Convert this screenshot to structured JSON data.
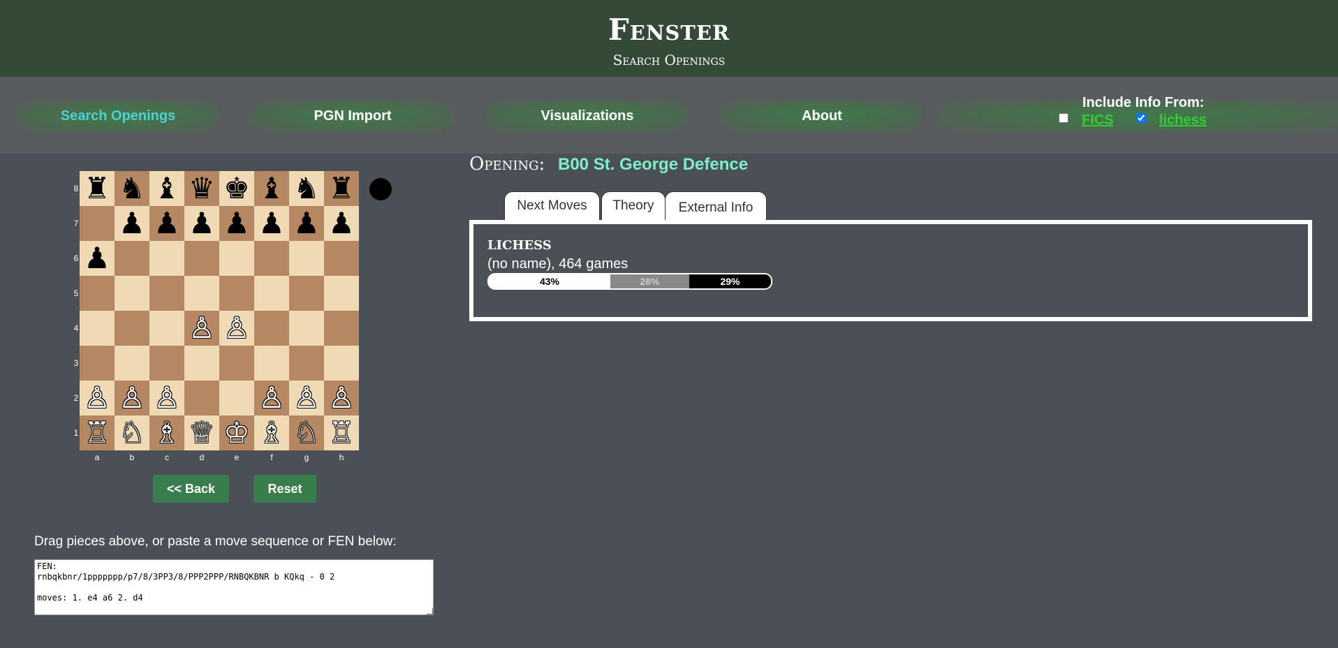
{
  "header": {
    "title": "Fenster",
    "subtitle": "Search Openings"
  },
  "nav": {
    "items": [
      "Search Openings",
      "PGN Import",
      "Visualizations",
      "About"
    ],
    "active": "Search Openings",
    "include_title": "Include Info From:",
    "sources": [
      {
        "label": "FICS",
        "checked": false
      },
      {
        "label": "lichess",
        "checked": true
      }
    ]
  },
  "board": {
    "pieces": [
      [
        "♜",
        "♞",
        "♝",
        "♛",
        "♚",
        "♝",
        "♞",
        "♜"
      ],
      [
        "",
        "♟",
        "♟",
        "♟",
        "♟",
        "♟",
        "♟",
        "♟"
      ],
      [
        "♟",
        "",
        "",
        "",
        "",
        "",
        "",
        ""
      ],
      [
        "",
        "",
        "",
        "",
        "",
        "",
        "",
        ""
      ],
      [
        "",
        "",
        "",
        "♙",
        "♙",
        "",
        "",
        ""
      ],
      [
        "",
        "",
        "",
        "",
        "",
        "",
        "",
        ""
      ],
      [
        "♙",
        "♙",
        "♙",
        "",
        "",
        "♙",
        "♙",
        "♙"
      ],
      [
        "♖",
        "♘",
        "♗",
        "♕",
        "♔",
        "♗",
        "♘",
        "♖"
      ]
    ],
    "ranks": [
      "8",
      "7",
      "6",
      "5",
      "4",
      "3",
      "2",
      "1"
    ],
    "files": [
      "a",
      "b",
      "c",
      "d",
      "e",
      "f",
      "g",
      "h"
    ],
    "turn": "black"
  },
  "buttons": {
    "back": "<< Back",
    "reset": "Reset"
  },
  "instructions": "Drag pieces above, or paste a move sequence or FEN below:",
  "fen_text": "FEN:\nrnbqkbnr/1ppppppp/p7/8/3PP3/8/PPP2PPP/RNBQKBNR b KQkq - 0 2\n\nmoves: 1. e4 a6 2. d4",
  "opening": {
    "label": "Opening:",
    "name": "B00 St. George Defence"
  },
  "tabs": {
    "items": [
      "Next Moves",
      "Theory",
      "External Info"
    ],
    "active": "External Info"
  },
  "external": {
    "source_title": "LICHESS",
    "info": "(no name), 464 games",
    "white_pct": "43%",
    "draw_pct": "28%",
    "black_pct": "29%",
    "white_fraction": 0.43,
    "draw_fraction": 0.28,
    "black_fraction": 0.29
  },
  "colors": {
    "header_bg": "#344a37",
    "accent_teal": "#4fd0d0",
    "opening_name": "#7df0c8",
    "link_green": "#33cc33",
    "button_green": "#3a7d4c"
  },
  "icons": {
    "turn_indicator": "black-turn-dot"
  }
}
